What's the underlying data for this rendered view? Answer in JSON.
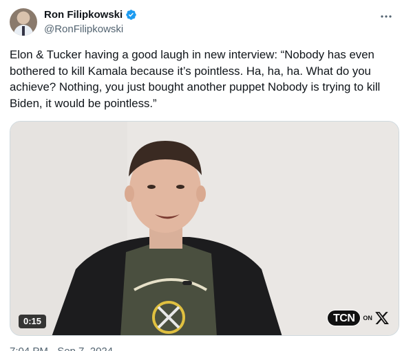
{
  "author": {
    "display_name": "Ron Filipkowski",
    "handle": "@RonFilipkowski",
    "verified": true,
    "verified_color": "#1d9bf0"
  },
  "tweet": {
    "text": "Elon & Tucker having a good laugh in new interview: “Nobody has even bothered to kill Kamala because it’s pointless. Ha, ha, ha. What do you achieve? Nothing, you just bought another puppet Nobody is trying to kill Biden, it would be pointless.”"
  },
  "media": {
    "type": "video",
    "duration": "0:15",
    "watermark_main": "TCN",
    "watermark_on": "ON"
  },
  "footer": {
    "timestamp_partial": "7:04 PM · Sep 7, 2024 · ..."
  }
}
